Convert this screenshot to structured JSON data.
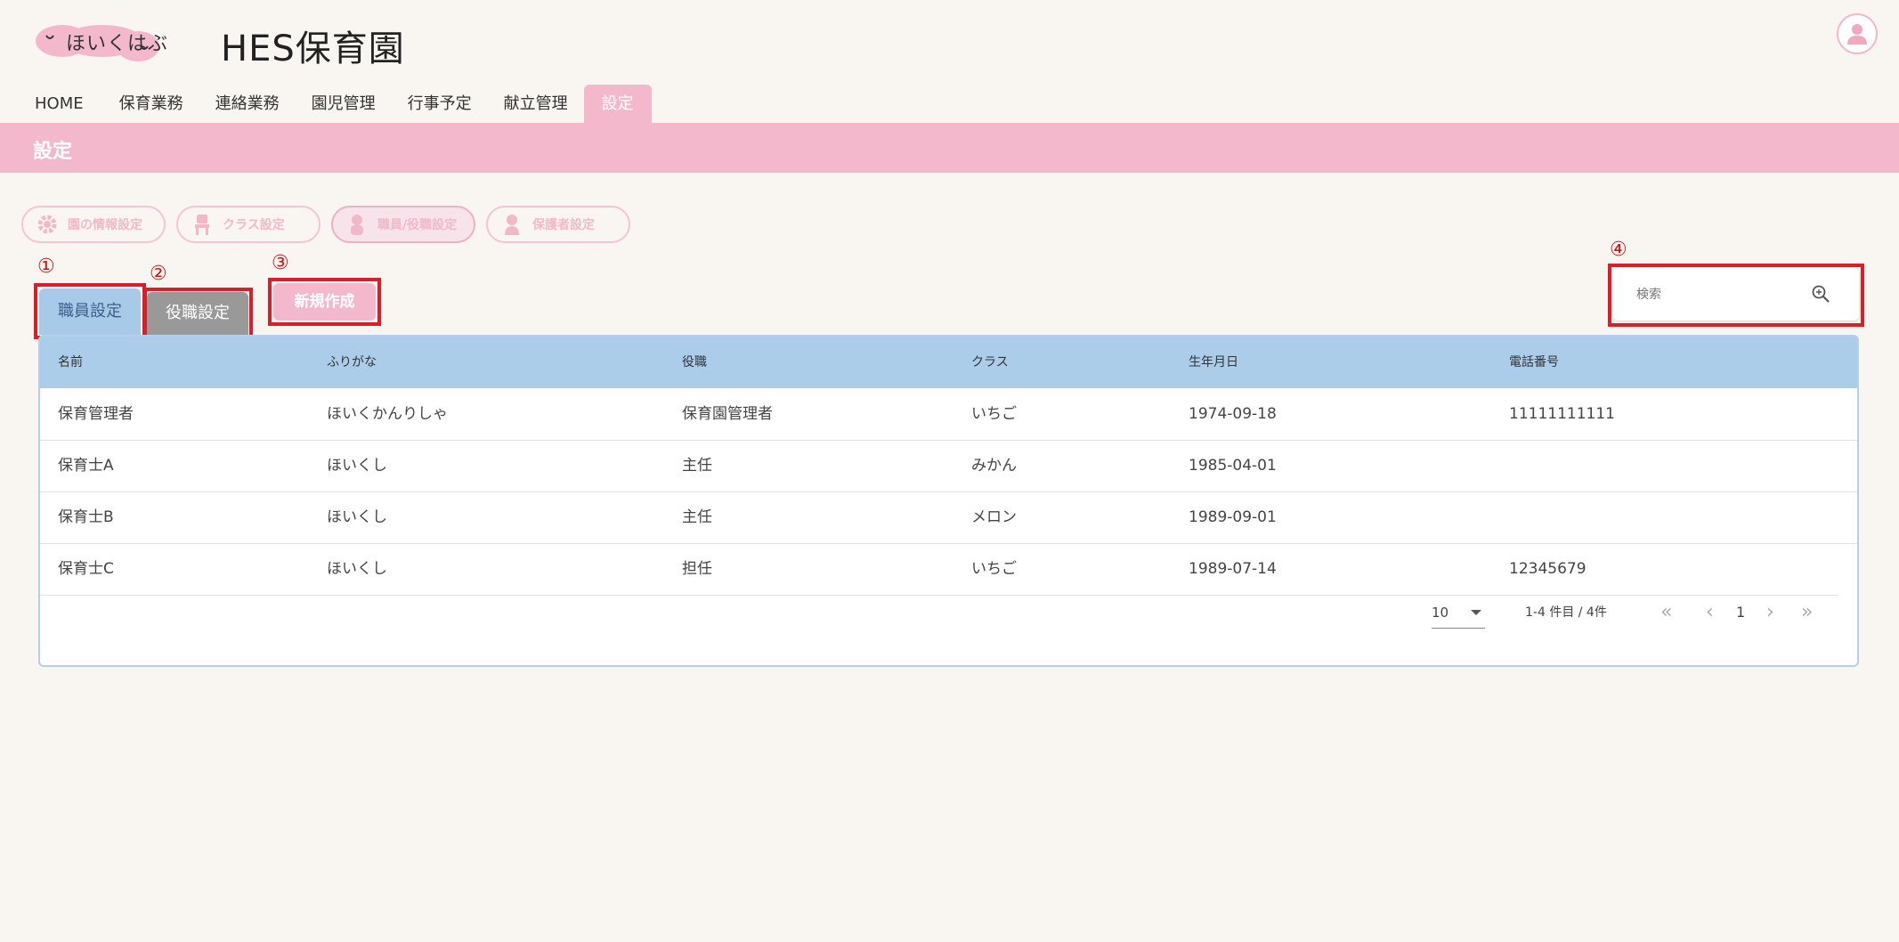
{
  "header": {
    "logo_text": "ほいくはぶ",
    "title": "HES保育園"
  },
  "nav": {
    "items": [
      {
        "label": "HOME"
      },
      {
        "label": "保育業務"
      },
      {
        "label": "連絡業務"
      },
      {
        "label": "園児管理"
      },
      {
        "label": "行事予定"
      },
      {
        "label": "献立管理"
      },
      {
        "label": "設定",
        "active": true
      }
    ]
  },
  "page": {
    "banner_title": "設定"
  },
  "settings_tabs": [
    {
      "label": "園の情報設定",
      "icon": "gear-icon"
    },
    {
      "label": "クラス設定",
      "icon": "chair-icon"
    },
    {
      "label": "職員/役職設定",
      "icon": "staff-icon",
      "selected": true
    },
    {
      "label": "保護者設定",
      "icon": "guardian-icon"
    }
  ],
  "annotations": [
    "①",
    "②",
    "③",
    "④"
  ],
  "tabs": {
    "staff": "職員設定",
    "role": "役職設定"
  },
  "new_button": "新規作成",
  "search": {
    "placeholder": "検索"
  },
  "table": {
    "columns": [
      "名前",
      "ふりがな",
      "役職",
      "クラス",
      "生年月日",
      "電話番号"
    ],
    "rows": [
      [
        "保育管理者",
        "ほいくかんりしゃ",
        "保育園管理者",
        "いちご",
        "1974-09-18",
        "11111111111"
      ],
      [
        "保育士A",
        "ほいくし",
        "主任",
        "みかん",
        "1985-04-01",
        ""
      ],
      [
        "保育士B",
        "ほいくし",
        "主任",
        "メロン",
        "1989-09-01",
        ""
      ],
      [
        "保育士C",
        "ほいくし",
        "担任",
        "いちご",
        "1989-07-14",
        "12345679"
      ]
    ]
  },
  "pagination": {
    "rows_per_page": "10",
    "range": "1-4 件目 / 4件",
    "page": "1",
    "first": "«",
    "prev": "‹",
    "next": "›",
    "last": "»"
  },
  "colors": {
    "accent_pink": "#f4b8cd",
    "table_header": "#abcdea",
    "annotation_red": "#d8202a"
  }
}
